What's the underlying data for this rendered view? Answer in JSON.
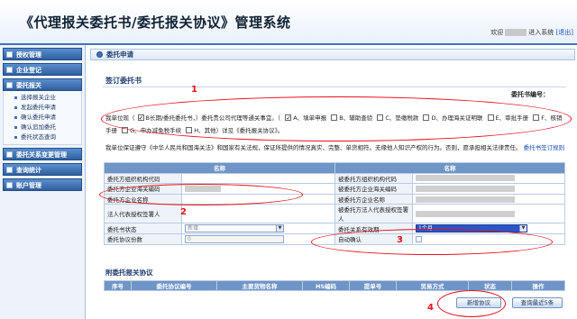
{
  "header": {
    "title": "《代理报关委托书/委托报关协议》管理系统",
    "welcome_prefix": "欢迎",
    "welcome_suffix": "进入系统",
    "exit_label": "[退出]"
  },
  "sidebar": {
    "groups": [
      {
        "label": "授权管理"
      },
      {
        "label": "企业登记"
      },
      {
        "label": "委托报关",
        "items": [
          "选择报关企业",
          "发起委托申请",
          "确认委托申请",
          "确认追加委托",
          "委托状态查询"
        ]
      },
      {
        "label": "委托关系变更管理"
      },
      {
        "label": "查询统计"
      },
      {
        "label": "账户管理"
      }
    ]
  },
  "main": {
    "breadcrumb": "委托申请",
    "section_title": "签订委托书",
    "contract_no_label": "委托书编号：",
    "matters": {
      "prefix": "我单位现（",
      "checked_mark": "√",
      "mid1": "B长期/委托委托书，）委托贵公司代理",
      "mid2": "等通关事宜。（",
      "options": [
        {
          "label": "A、填单申报",
          "checked": true
        },
        {
          "label": "B、辅助查验",
          "checked": false
        },
        {
          "label": "C、垫缴税款",
          "checked": false
        },
        {
          "label": "D、办理海关证明联",
          "checked": false
        },
        {
          "label": "E、审批手册",
          "checked": false
        },
        {
          "label": "F、核销手册",
          "checked": false
        },
        {
          "label": "G、申办减免税手续",
          "checked": false
        },
        {
          "label": "H、其他",
          "checked": false
        }
      ],
      "suffix": "）详见《委托报关协议》。"
    },
    "promise": {
      "text": "我单位保证遵守《中华人民共和国海关法》和国家有关法规，保证所提供的情况真实、完整、单货相符。无缘他人知识产权的行为。否则，愿承担相关法律责任。",
      "link": "委托书签订规则"
    },
    "form": {
      "header_left": "名称",
      "header_right": "名称",
      "rows": [
        {
          "left_label": "委托方组织机构代码",
          "left_value": "",
          "right_label": "被委托方组织机构代码",
          "right_value": ""
        },
        {
          "left_label": "委托方企业海关编码",
          "left_value": "",
          "right_label": "被委托方企业海关编码",
          "right_value": ""
        },
        {
          "left_label": "委托方企业名称",
          "left_value": "",
          "right_label": "被委托方企业名称",
          "right_value": ""
        },
        {
          "left_label": "法人代表授权签署人",
          "left_value": "",
          "right_label": "被委托方法人代表授权签署人",
          "right_value": ""
        },
        {
          "left_label": "委托书状态",
          "left_value": "新增",
          "right_label": "委托关系有效期",
          "right_value": "1个月"
        },
        {
          "left_label": "委托协议份数",
          "left_value": "0",
          "right_label": "自动确认",
          "right_value": ""
        }
      ]
    },
    "attachment": {
      "title": "附委托报关协议",
      "columns": [
        "序号",
        "委托协议编号",
        "主要货物名称",
        "HS编码",
        "提单号",
        "贸易方式",
        "状态",
        "操作"
      ]
    },
    "buttons": {
      "add_agreement": "新增协议",
      "recent_query": "查询最近5条"
    },
    "annotations": [
      "1",
      "2",
      "3",
      "4"
    ]
  }
}
